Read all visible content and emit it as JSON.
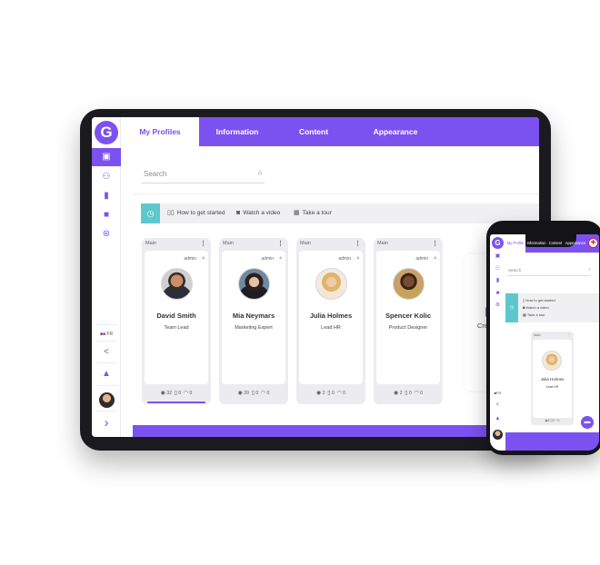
{
  "logo": {
    "glyph": "G"
  },
  "tabs": [
    {
      "label": "My Profiles"
    },
    {
      "label": "Information"
    },
    {
      "label": "Content"
    },
    {
      "label": "Appearance"
    }
  ],
  "search": {
    "placeholder": "Search"
  },
  "help": {
    "items": [
      {
        "label": "How to get started",
        "icon": "book-icon"
      },
      {
        "label": "Watch a video",
        "icon": "camera-icon"
      },
      {
        "label": "Take a tour",
        "icon": "calendar-icon"
      }
    ]
  },
  "sidebar": {
    "language": "FR"
  },
  "profiles": [
    {
      "tag": "Main",
      "badge": "admin",
      "name": "David Smith",
      "role": "Team Lead",
      "views": "32",
      "shares": "0",
      "connections": "0"
    },
    {
      "tag": "Main",
      "badge": "admin",
      "name": "Mia Neymars",
      "role": "Marketing Expert",
      "views": "39",
      "shares": "0",
      "connections": "0"
    },
    {
      "tag": "Main",
      "badge": "admin",
      "name": "Julia Holmes",
      "role": "Lead HR",
      "views": "2",
      "shares": "0",
      "connections": "0"
    },
    {
      "tag": "Main",
      "badge": "admin",
      "name": "Spencer Kolic",
      "role": "Product Designer",
      "views": "2",
      "shares": "0",
      "connections": "0"
    }
  ],
  "create": {
    "label": "Create"
  },
  "phone": {
    "tabs": [
      {
        "label": "My Profile"
      },
      {
        "label": "Information"
      },
      {
        "label": "Content"
      },
      {
        "label": "Appearance"
      }
    ],
    "search_placeholder": "Search",
    "help_items": [
      "How to get started",
      "Watch a video",
      "Take a tour"
    ],
    "language": "FR",
    "profile": {
      "tag": "Main",
      "name": "Julia Holmes",
      "role": "Lead HR",
      "views": "2",
      "shares": "0",
      "connections": "0"
    }
  },
  "colors": {
    "accent": "#7b52f0",
    "help": "#5ec7ce",
    "device": "#1b1b1f"
  }
}
